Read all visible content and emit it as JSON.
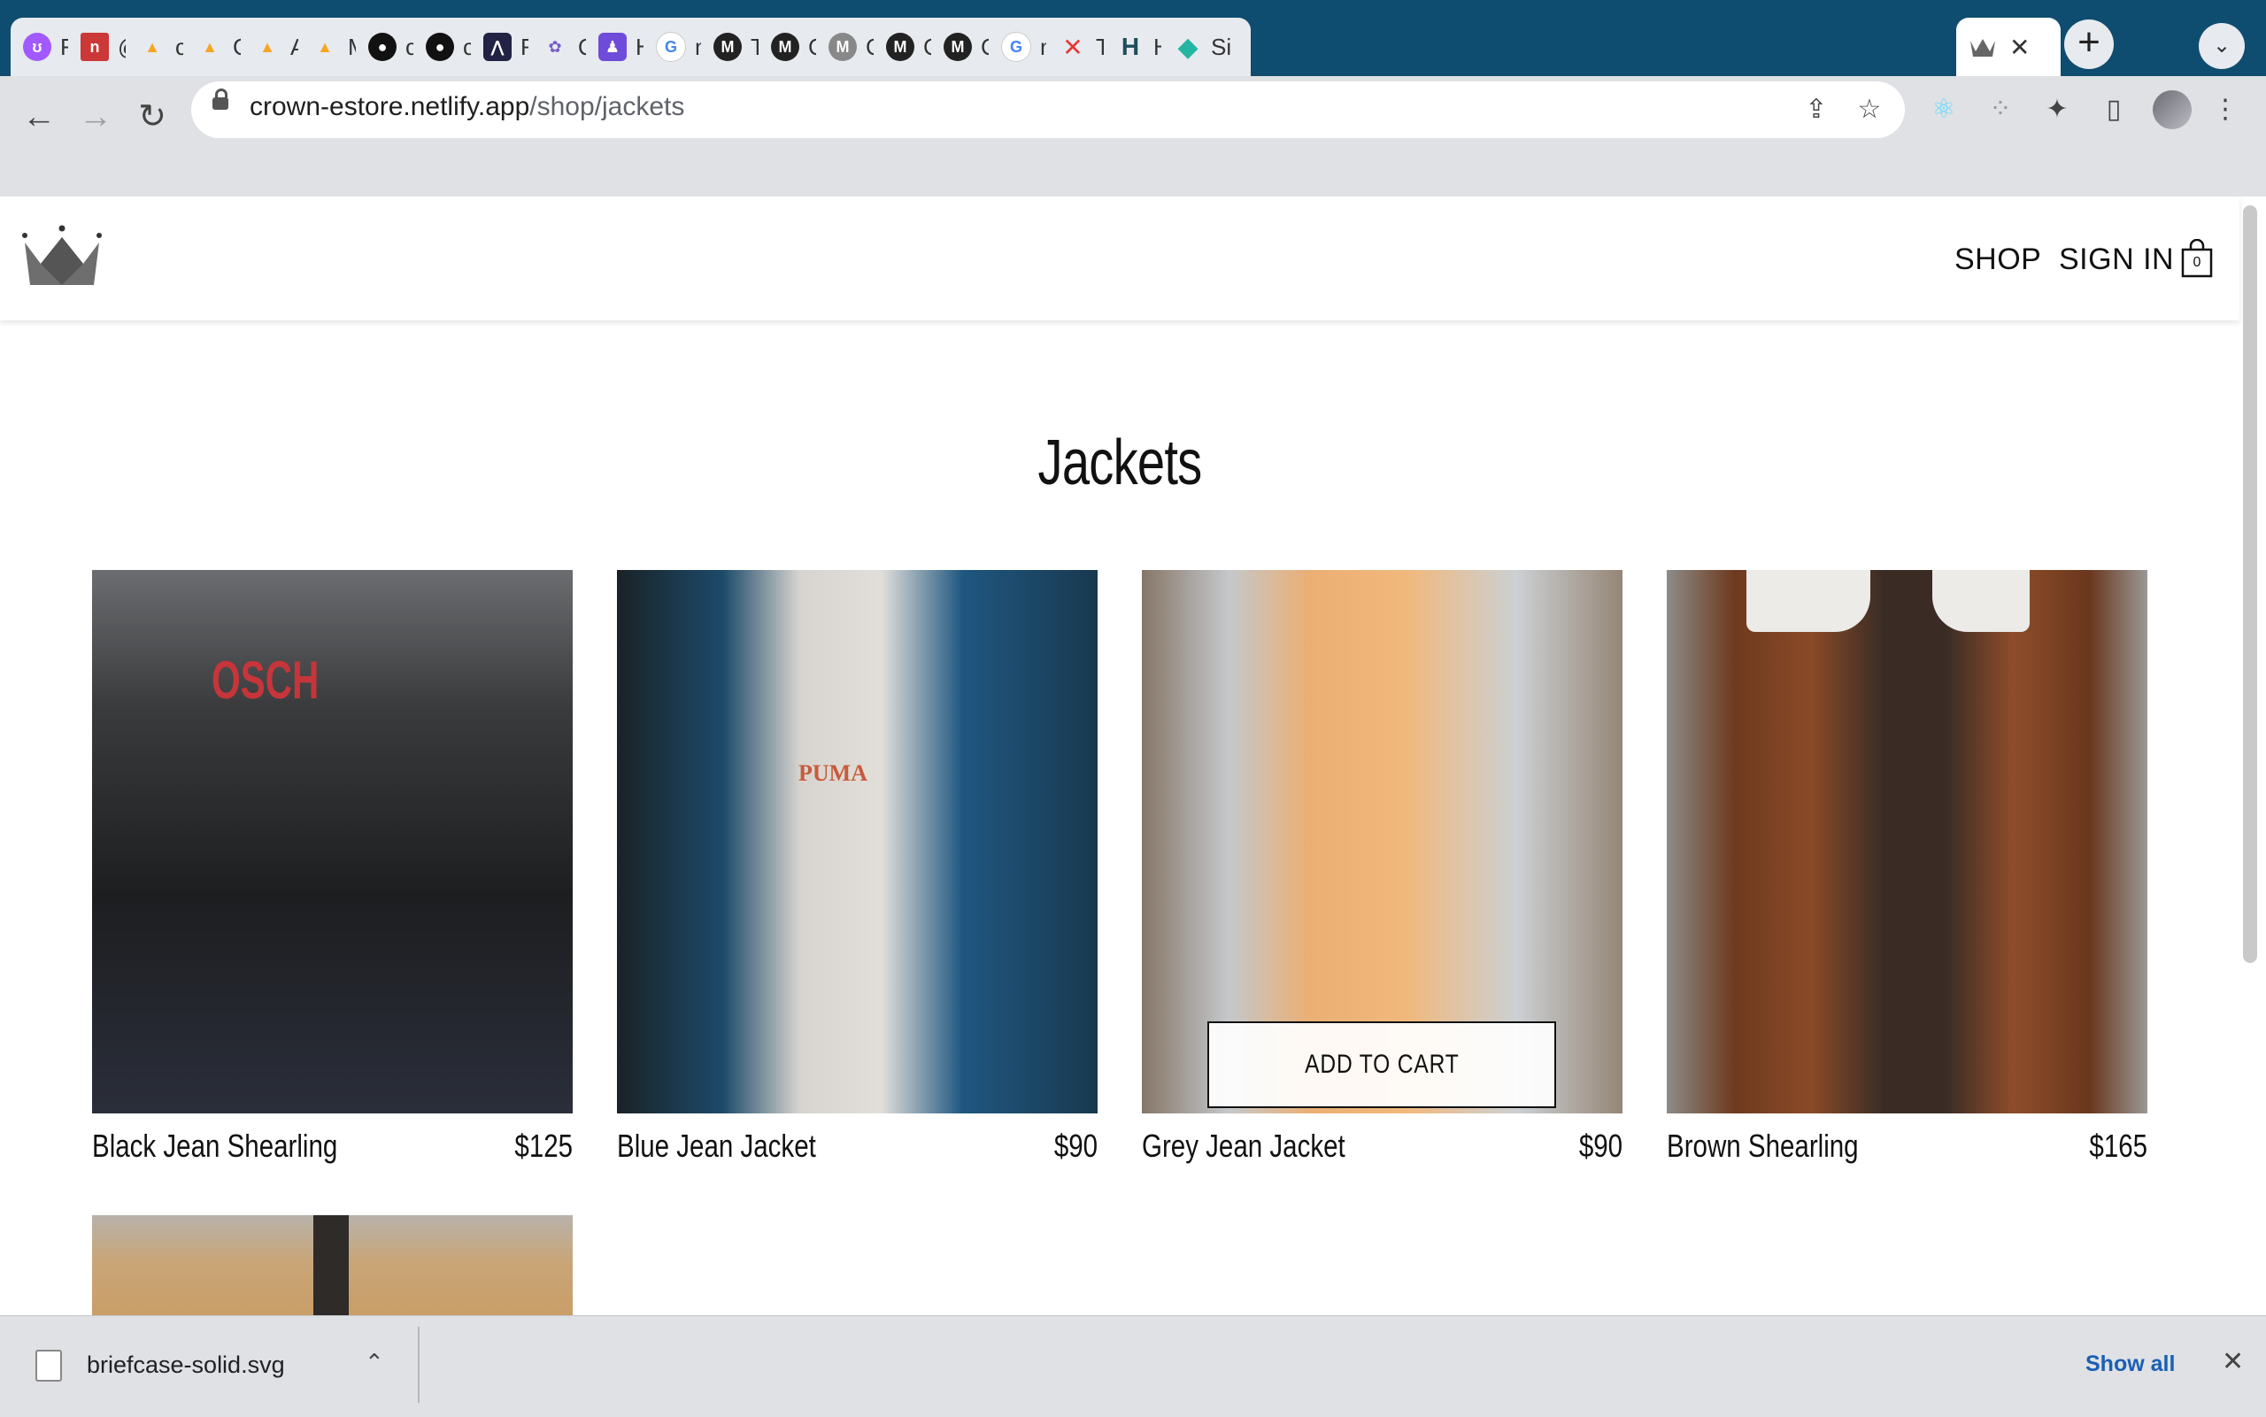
{
  "browser": {
    "tabs": [
      {
        "title": "Figma",
        "icon": "figma-icon",
        "color": "#a259ff"
      },
      {
        "title": "@ref",
        "icon": "npm-icon",
        "color": "#cb3837"
      },
      {
        "title": "cloud",
        "icon": "firebase-icon",
        "color": "#f5a623"
      },
      {
        "title": "Get started",
        "icon": "firebase-icon",
        "color": "#f5a623"
      },
      {
        "title": "Add",
        "icon": "firebase-icon",
        "color": "#f5a623"
      },
      {
        "title": "Manage",
        "icon": "firebase-icon",
        "color": "#f5a623"
      },
      {
        "title": "crown",
        "icon": "github-icon",
        "color": "#111111"
      },
      {
        "title": "crown",
        "icon": "github-icon",
        "color": "#111111"
      },
      {
        "title": "React",
        "icon": "redux-icon",
        "color": "#222244"
      },
      {
        "title": "Query",
        "icon": "graphql-icon",
        "color": "#7a5cc9"
      },
      {
        "title": "Hasura",
        "icon": "hasura-icon",
        "color": "#6e4bd9"
      },
      {
        "title": "map",
        "icon": "google-icon",
        "color": "#4285f4"
      },
      {
        "title": "The",
        "icon": "mui-icon",
        "color": "#222222"
      },
      {
        "title": "Component",
        "icon": "mui-icon",
        "color": "#222222"
      },
      {
        "title": "Cart",
        "icon": "mui-icon",
        "color": "#777777"
      },
      {
        "title": "Card",
        "icon": "mui-icon",
        "color": "#222222"
      },
      {
        "title": "Cart",
        "icon": "mui-icon",
        "color": "#222222"
      },
      {
        "title": "map",
        "icon": "google-icon",
        "color": "#4285f4"
      },
      {
        "title": "Toast",
        "icon": "x-brand-icon",
        "color": "#e53935"
      },
      {
        "title": "Heroku",
        "icon": "heroku-icon",
        "color": "#1e4d5c"
      },
      {
        "title": "Site",
        "icon": "netlify-icon",
        "color": "#25b6a3"
      }
    ],
    "active_tab": {
      "icon": "crown-favicon-icon",
      "close": "✕"
    },
    "tab_abbrev": [
      "Fig",
      "@r",
      "clc",
      "Ge",
      "Ac",
      "Ma",
      "cr",
      "cr",
      "Re",
      "Qu",
      "Ha",
      "m",
      "Th",
      "Cc",
      "Ca",
      "Ca",
      "Ca",
      "m",
      "To",
      "He",
      "Si"
    ],
    "url": {
      "host": "crown-estore.netlify.app",
      "path": "/shop/jackets"
    }
  },
  "site": {
    "nav": {
      "shop": "SHOP",
      "sign_in": "SIGN IN",
      "cart_count": "0"
    },
    "page_title": "Jackets",
    "add_to_cart": "ADD TO CART",
    "products": [
      {
        "name": "Black Jean Shearling",
        "price": "$125"
      },
      {
        "name": "Blue Jean Jacket",
        "price": "$90"
      },
      {
        "name": "Grey Jean Jacket",
        "price": "$90"
      },
      {
        "name": "Brown Shearling",
        "price": "$165"
      }
    ]
  },
  "download_bar": {
    "file_name": "briefcase-solid.svg",
    "show_all": "Show all"
  }
}
